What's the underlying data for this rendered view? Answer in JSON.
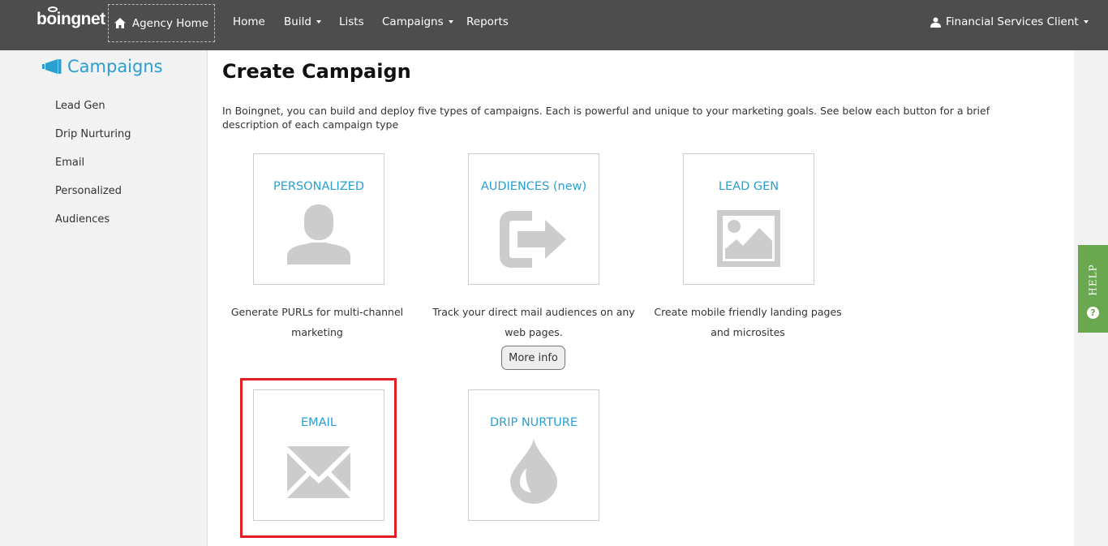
{
  "brand": {
    "logo_text": "boingnet"
  },
  "nav": {
    "agency_home": "Agency Home",
    "items": [
      {
        "label": "Home",
        "has_caret": false
      },
      {
        "label": "Build",
        "has_caret": true
      },
      {
        "label": "Lists",
        "has_caret": false
      },
      {
        "label": "Campaigns",
        "has_caret": true
      },
      {
        "label": "Reports",
        "has_caret": false
      }
    ],
    "user": "Financial Services Client"
  },
  "sidebar": {
    "title": "Campaigns",
    "items": [
      {
        "label": "Lead Gen"
      },
      {
        "label": "Drip Nurturing"
      },
      {
        "label": "Email"
      },
      {
        "label": "Personalized"
      },
      {
        "label": "Audiences"
      }
    ]
  },
  "main": {
    "title": "Create Campaign",
    "intro": "In Boingnet, you can build and deploy five types of campaigns. Each is powerful and unique to your marketing goals. See below each button for a brief description of each campaign type",
    "cards": [
      {
        "title": "PERSONALIZED",
        "icon": "user-silhouette-icon",
        "desc_line1": "Generate PURLs for multi-channel",
        "desc_line2": "marketing"
      },
      {
        "title": "AUDIENCES (new)",
        "icon": "sign-out-arrow-icon",
        "desc_line1": "Track your direct mail audiences on any",
        "desc_line2": "web pages.",
        "more_info": "More info"
      },
      {
        "title": "LEAD GEN",
        "icon": "image-picture-icon",
        "desc_line1": "Create mobile friendly landing pages",
        "desc_line2": "and microsites"
      },
      {
        "title": "EMAIL",
        "icon": "envelope-icon",
        "highlighted": true
      },
      {
        "title": "DRIP NURTURE",
        "icon": "water-drop-icon"
      }
    ]
  },
  "help": {
    "label": "HELP",
    "icon_glyph": "?"
  },
  "colors": {
    "accent": "#2a9fd0",
    "nav_bg": "#4d4d4d",
    "help_bg": "#6aa84f",
    "highlight": "#e31e24",
    "icon_gray": "#cccccc"
  }
}
